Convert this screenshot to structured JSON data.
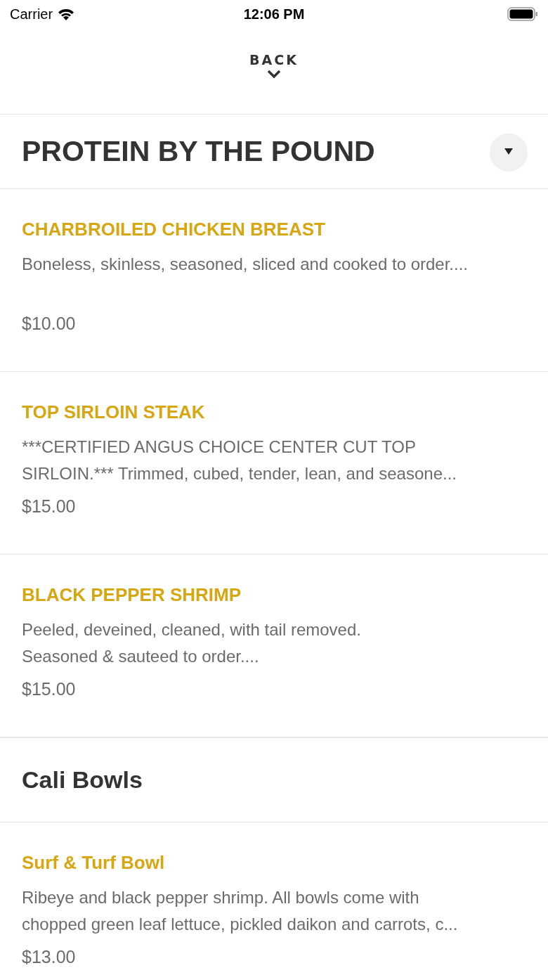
{
  "status_bar": {
    "carrier": "Carrier",
    "time": "12:06 PM"
  },
  "header": {
    "back_label": "BACK"
  },
  "sections": [
    {
      "title": "PROTEIN BY THE POUND",
      "kind": "category",
      "items": [
        {
          "name": "CHARBROILED CHICKEN BREAST",
          "description": "Boneless, skinless, seasoned, sliced and cooked to order....",
          "price": "$10.00"
        },
        {
          "name": "TOP SIRLOIN STEAK",
          "description": "***CERTIFIED ANGUS CHOICE CENTER CUT TOP\nSIRLOIN.***  Trimmed, cubed, tender, lean, and seasone...",
          "price": "$15.00"
        },
        {
          "name": "BLACK PEPPER SHRIMP",
          "description": "Peeled, deveined, cleaned, with tail removed.\nSeasoned & sauteed to order....",
          "price": "$15.00"
        }
      ]
    },
    {
      "title": "Cali Bowls",
      "kind": "group",
      "items": [
        {
          "name": "Surf & Turf Bowl",
          "description": "Ribeye and black pepper shrimp. All bowls come with\nchopped green leaf lettuce, pickled daikon and carrots, c...",
          "price": "$13.00"
        }
      ]
    }
  ]
}
